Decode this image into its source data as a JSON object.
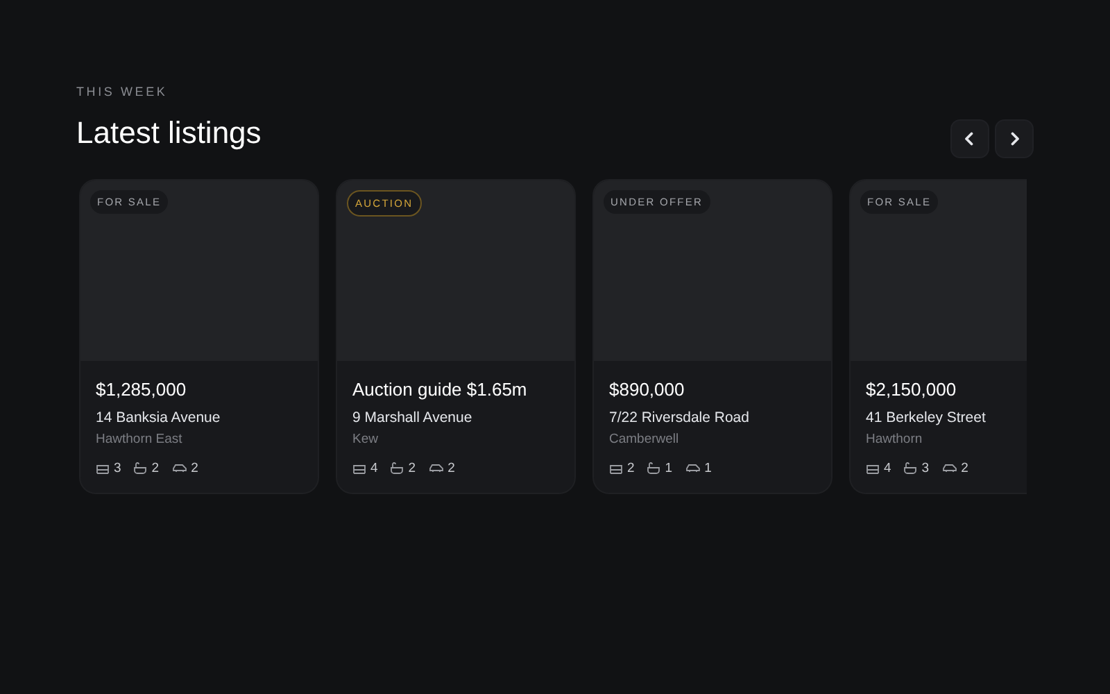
{
  "section": {
    "eyebrow": "THIS WEEK",
    "title": "Latest listings",
    "nav": [
      {
        "kind": "prev"
      },
      {
        "kind": "next"
      }
    ]
  },
  "listings": [
    {
      "badge": {
        "label": "FOR SALE",
        "kind": "standard"
      },
      "price": "$1,285,000",
      "address": "14 Banksia Avenue",
      "suburb": "Hawthorn East",
      "beds": "3",
      "baths": "2",
      "cars": "2"
    },
    {
      "badge": {
        "label": "AUCTION",
        "kind": "auction"
      },
      "price": "Auction guide $1.65m",
      "address": "9 Marshall Avenue",
      "suburb": "Kew",
      "beds": "4",
      "baths": "2",
      "cars": "2"
    },
    {
      "badge": {
        "label": "UNDER OFFER",
        "kind": "standard"
      },
      "price": "$890,000",
      "address": "7/22 Riversdale Road",
      "suburb": "Camberwell",
      "beds": "2",
      "baths": "1",
      "cars": "1"
    },
    {
      "badge": {
        "label": "FOR SALE",
        "kind": "standard"
      },
      "price": "$2,150,000",
      "address": "41 Berkeley Street",
      "suburb": "Hawthorn",
      "beds": "4",
      "baths": "3",
      "cars": "2"
    }
  ]
}
